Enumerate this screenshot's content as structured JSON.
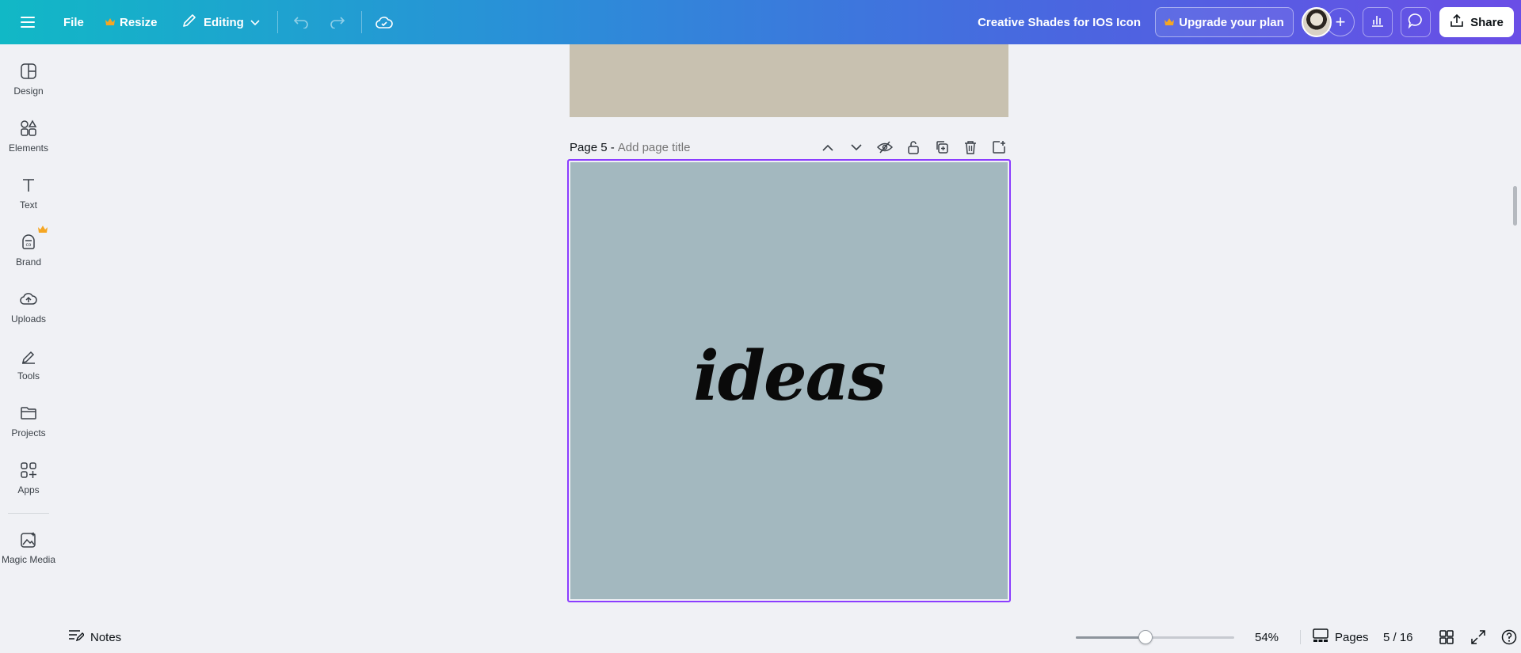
{
  "topbar": {
    "file_label": "File",
    "resize_label": "Resize",
    "editing_label": "Editing",
    "doc_title": "Creative Shades for IOS Icon",
    "upgrade_label": "Upgrade your plan",
    "share_label": "Share",
    "crown_color": "#f5a623"
  },
  "sidebar": {
    "items": [
      {
        "label": "Design",
        "icon": "design-icon"
      },
      {
        "label": "Elements",
        "icon": "elements-icon"
      },
      {
        "label": "Text",
        "icon": "text-icon"
      },
      {
        "label": "Brand",
        "icon": "brand-icon"
      },
      {
        "label": "Uploads",
        "icon": "uploads-icon"
      },
      {
        "label": "Tools",
        "icon": "tools-icon"
      },
      {
        "label": "Projects",
        "icon": "projects-icon"
      },
      {
        "label": "Apps",
        "icon": "apps-icon"
      },
      {
        "label": "Magic Media",
        "icon": "magic-media-icon"
      }
    ]
  },
  "canvas": {
    "page_label": "Page 5 -",
    "page_title_placeholder": "Add page title",
    "page_text": "ideas",
    "page_bg": "#a3b8bf",
    "prev_page_bg": "#c8c1b0",
    "selection_color": "#8b3dff"
  },
  "bottombar": {
    "notes_label": "Notes",
    "zoom_value": "54%",
    "zoom_fraction": 0.44,
    "pages_label": "Pages",
    "page_count": "5 / 16"
  }
}
